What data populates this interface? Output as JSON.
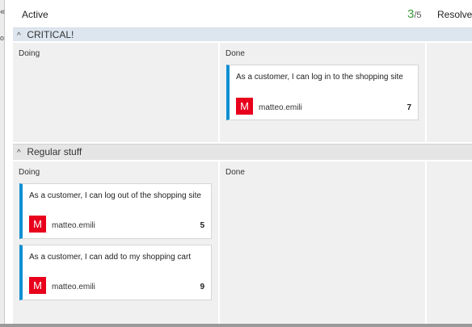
{
  "header": {
    "active_label": "Active",
    "count_done": "3",
    "count_total": "/5",
    "resolved_label": "Resolved"
  },
  "frame": {
    "left_glyph_top": "«",
    "left_glyph_mid": "o"
  },
  "swimlanes": [
    {
      "title": "CRITICAL!",
      "columns": [
        {
          "label": "Doing",
          "cards": []
        },
        {
          "label": "Done",
          "cards": [
            {
              "title": "As a customer, I can log in to the shopping site",
              "avatar_letter": "M",
              "assignee": "matteo.emili",
              "estimate": "7"
            }
          ]
        }
      ]
    },
    {
      "title": "Regular stuff",
      "columns": [
        {
          "label": "Doing",
          "cards": [
            {
              "title": "As a customer, I can log out of the shopping site",
              "avatar_letter": "M",
              "assignee": "matteo.emili",
              "estimate": "5"
            },
            {
              "title": "As a customer, I can add to my shopping cart",
              "avatar_letter": "M",
              "assignee": "matteo.emili",
              "estimate": "9"
            }
          ]
        },
        {
          "label": "Done",
          "cards": []
        }
      ]
    }
  ],
  "colors": {
    "card_accent": "#0f8fd1",
    "avatar_bg": "#e8001c",
    "count_green": "#3a9a3a"
  }
}
